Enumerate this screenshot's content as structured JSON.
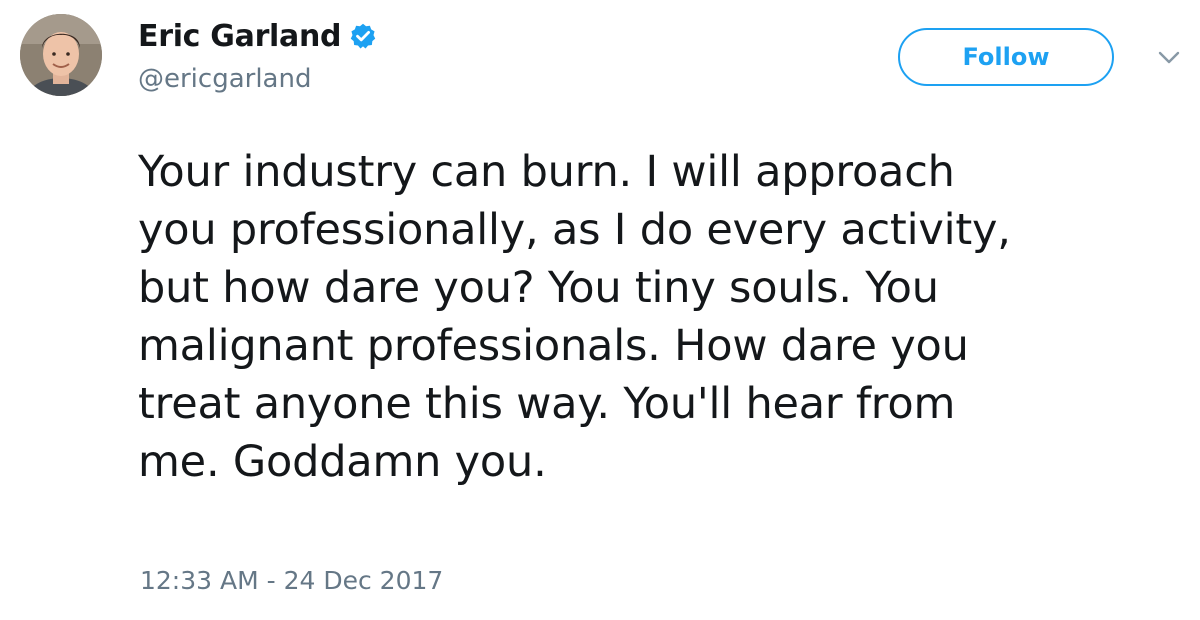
{
  "author": {
    "display_name": "Eric Garland",
    "handle": "@ericgarland",
    "verified": true
  },
  "actions": {
    "follow_label": "Follow"
  },
  "tweet": {
    "lines": [
      "Your industry can burn. I will approach",
      "you professionally, as I do every activity,",
      "but how dare you? You tiny souls. You",
      "malignant professionals. How dare you",
      "treat anyone this way. You'll hear from",
      "me. Goddamn you."
    ],
    "timestamp": "12:33 AM - 24 Dec 2017"
  },
  "icons": {
    "verified": "verified-badge-icon",
    "caret": "chevron-down-icon"
  },
  "colors": {
    "accent": "#1da1f2",
    "text": "#14171a",
    "secondary_text": "#657786"
  }
}
